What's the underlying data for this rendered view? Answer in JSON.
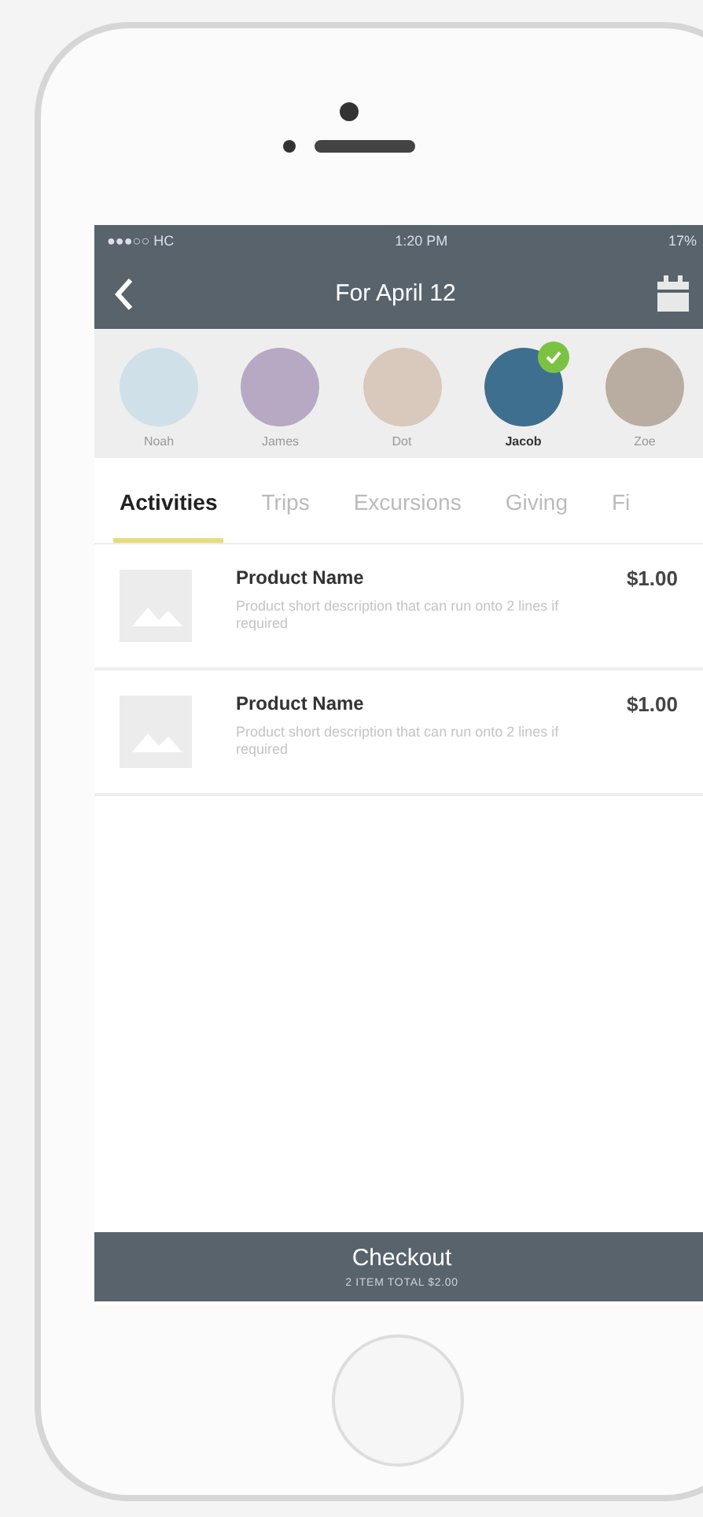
{
  "status_bar": {
    "carrier": "●●●○○ HC",
    "time": "1:20 PM",
    "battery": "17%"
  },
  "nav": {
    "title": "For April 12"
  },
  "people": [
    {
      "name": "Noah",
      "selected": false
    },
    {
      "name": "James",
      "selected": false
    },
    {
      "name": "Dot",
      "selected": false
    },
    {
      "name": "Jacob",
      "selected": true
    },
    {
      "name": "Zoe",
      "selected": false
    }
  ],
  "tabs": [
    {
      "label": "Activities",
      "selected": true
    },
    {
      "label": "Trips",
      "selected": false
    },
    {
      "label": "Excursions",
      "selected": false
    },
    {
      "label": "Giving",
      "selected": false
    },
    {
      "label": "Fi",
      "selected": false
    }
  ],
  "products": [
    {
      "name": "Product Name",
      "description": "Product short description that can run onto 2 lines if required",
      "price": "$1.00"
    },
    {
      "name": "Product Name",
      "description": "Product short description that can run onto 2 lines if required",
      "price": "$1.00"
    }
  ],
  "checkout": {
    "label": "Checkout",
    "summary": "2 ITEM TOTAL $2.00"
  }
}
